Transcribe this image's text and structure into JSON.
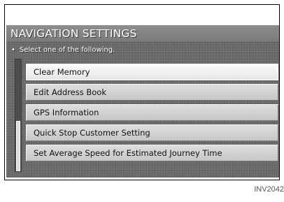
{
  "window": {
    "title": "NAVIGATION SETTINGS",
    "instruction": "Select one of the following.",
    "bullet": "•"
  },
  "menu": {
    "items": [
      {
        "label": "Clear Memory",
        "selected": true
      },
      {
        "label": "Edit Address Book",
        "selected": false
      },
      {
        "label": "GPS Information",
        "selected": false
      },
      {
        "label": "Quick Stop Customer Setting",
        "selected": false
      },
      {
        "label": "Set Average Speed for Estimated Journey Time",
        "selected": false
      }
    ]
  },
  "figure_code": "INV2042",
  "colors": {
    "screen_background": "#6f6f6f",
    "title_bar": "#858585",
    "menu_item": "#d2d2d2",
    "menu_item_selected": "#f2f2f2"
  }
}
